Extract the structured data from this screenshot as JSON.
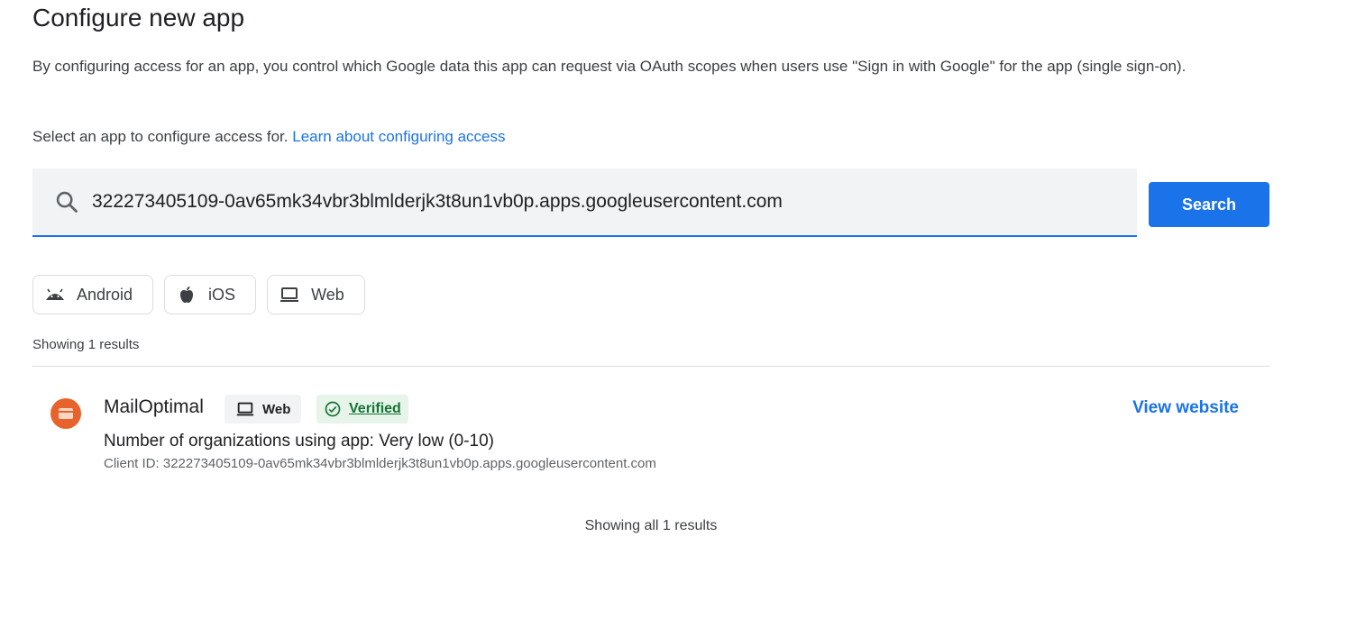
{
  "page": {
    "title": "Configure new app",
    "description": "By configuring access for an app, you control which Google data this app can request via OAuth scopes when users use \"Sign in with Google\" for the app (single sign-on).",
    "select_prompt": "Select an app to configure access for.",
    "learn_link": "Learn about configuring access"
  },
  "search": {
    "value": "322273405109-0av65mk34vbr3blmlderjk3t8un1vb0p.apps.googleusercontent.com",
    "button_label": "Search",
    "icon": "search-icon"
  },
  "filters": [
    {
      "label": "Android",
      "icon": "android-icon"
    },
    {
      "label": "iOS",
      "icon": "apple-icon"
    },
    {
      "label": "Web",
      "icon": "laptop-icon"
    }
  ],
  "results_summary": "Showing 1 results",
  "result": {
    "name": "MailOptimal",
    "platform_badge": "Web",
    "verified_badge": "Verified",
    "orgs_text": "Number of organizations using app: Very low (0-10)",
    "client_id_text": "Client ID: 322273405109-0av65mk34vbr3blmlderjk3t8un1vb0p.apps.googleusercontent.com",
    "view_website": "View website",
    "logo_color": "#e8622c"
  },
  "footer_summary": "Showing all 1 results",
  "colors": {
    "accent": "#1a73e8",
    "verified_green": "#137333",
    "verified_bg": "#e6f4ea"
  }
}
